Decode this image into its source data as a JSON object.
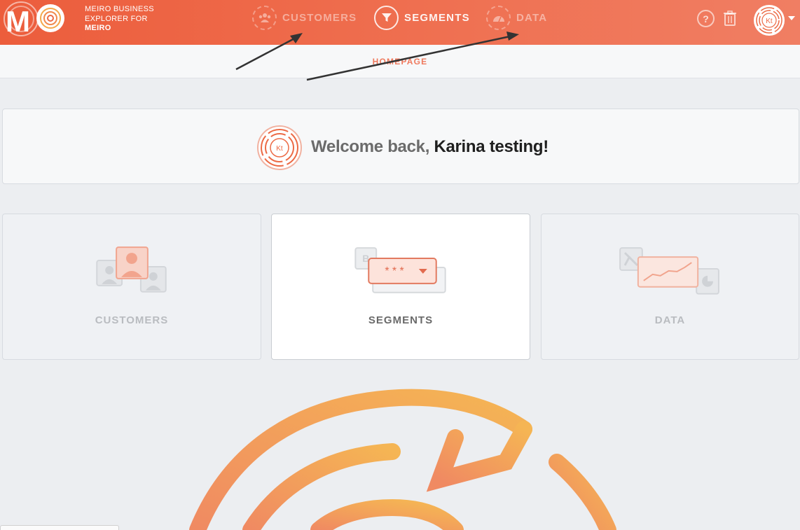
{
  "brand": {
    "line1": "MEIRO BUSINESS",
    "line2": "EXPLORER FOR",
    "line3": "MEIRO",
    "colors": {
      "primary": "#ec5d3c",
      "accent": "#f5a84b"
    }
  },
  "nav": {
    "items": [
      {
        "label": "CUSTOMERS",
        "icon": "people-icon",
        "active": false
      },
      {
        "label": "SEGMENTS",
        "icon": "funnel-icon",
        "active": true
      },
      {
        "label": "DATA",
        "icon": "gauge-icon",
        "active": false
      }
    ],
    "help_label": "?",
    "trash_icon": "trash-icon",
    "avatar_initials": "Kt"
  },
  "breadcrumb": {
    "label": "HOMEPAGE"
  },
  "welcome": {
    "prefix": "Welcome back, ",
    "name": "Karina testing!",
    "avatar_initials": "Kt"
  },
  "tiles": [
    {
      "label": "CUSTOMERS",
      "icon": "customers-illustration",
      "active": false
    },
    {
      "label": "SEGMENTS",
      "icon": "segments-illustration",
      "active": true,
      "illustration_text": "* * *"
    },
    {
      "label": "DATA",
      "icon": "data-illustration",
      "active": false
    }
  ]
}
